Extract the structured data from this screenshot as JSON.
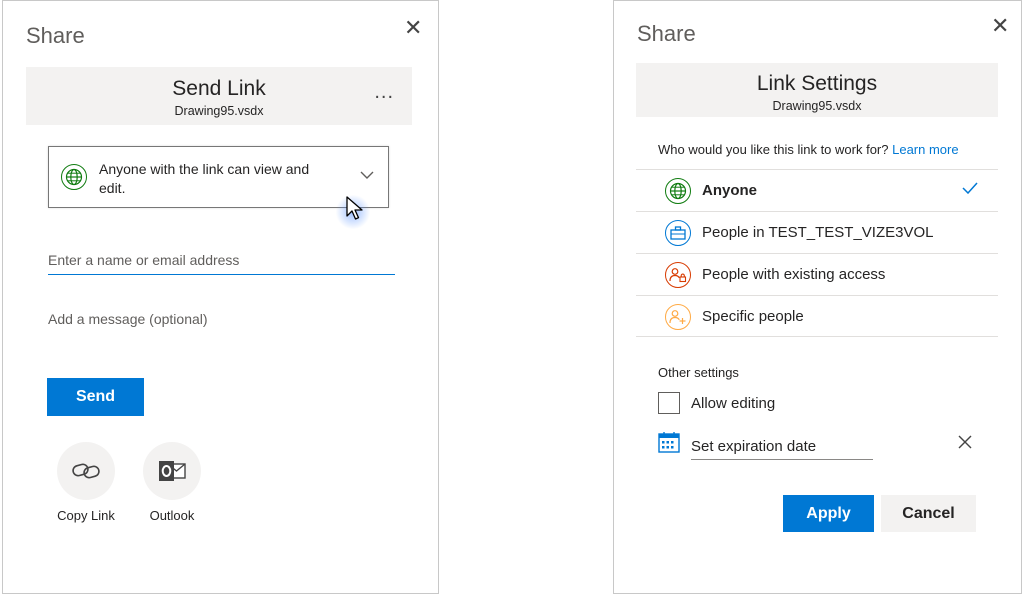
{
  "send_link_pane": {
    "title": "Share",
    "header_title": "Send Link",
    "file_name": "Drawing95.vsdx",
    "more_label": "...",
    "permission_text": "Anyone with the link can view and edit.",
    "email_placeholder": "Enter a name or email address",
    "message_placeholder": "Add a message (optional)",
    "send_label": "Send",
    "share_options": [
      {
        "label": "Copy Link",
        "icon": "link-icon"
      },
      {
        "label": "Outlook",
        "icon": "outlook-icon"
      }
    ]
  },
  "link_settings_pane": {
    "title": "Share",
    "header_title": "Link Settings",
    "file_name": "Drawing95.vsdx",
    "question": "Who would you like this link to work for?",
    "learn_more": "Learn more",
    "options": [
      {
        "label": "Anyone",
        "icon": "globe-icon",
        "color": "#107c10",
        "selected": true
      },
      {
        "label": "People in TEST_TEST_VIZE3VOL",
        "icon": "briefcase-icon",
        "color": "#0078d4",
        "selected": false
      },
      {
        "label": "People with existing access",
        "icon": "people-lock-icon",
        "color": "#d83b01",
        "selected": false
      },
      {
        "label": "Specific people",
        "icon": "people-add-icon",
        "color": "#ffaa44",
        "selected": false
      }
    ],
    "other_settings_label": "Other settings",
    "allow_editing_label": "Allow editing",
    "allow_editing_checked": false,
    "expiration_placeholder": "Set expiration date",
    "apply_label": "Apply",
    "cancel_label": "Cancel"
  },
  "colors": {
    "accent": "#0078d4",
    "header_bg": "#f3f2f1",
    "text": "#252424"
  }
}
